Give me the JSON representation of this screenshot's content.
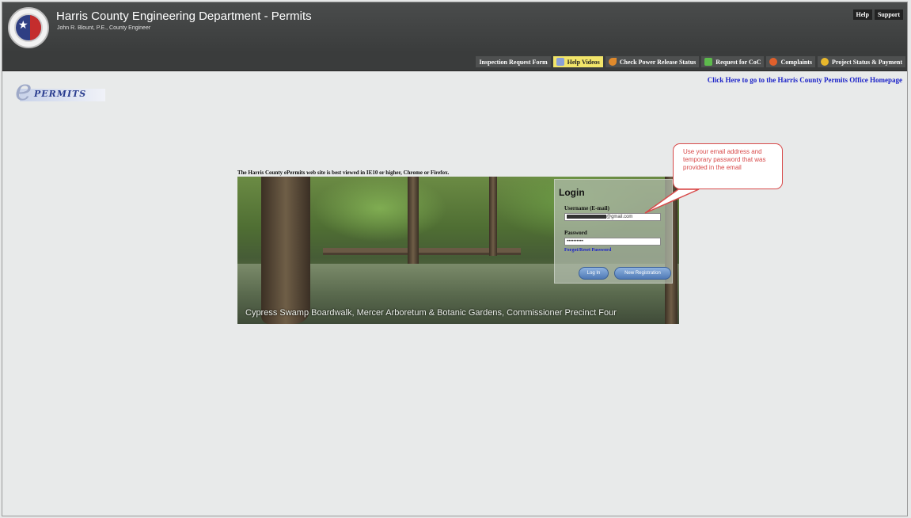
{
  "header": {
    "title": "Harris County Engineering Department - Permits",
    "subtitle": "John R. Blount, P.E., County Engineer",
    "top_links": [
      "Help",
      "Support"
    ]
  },
  "nav": {
    "items": [
      {
        "label": "Inspection Request Form",
        "icon": "",
        "active": false
      },
      {
        "label": "Help Videos",
        "icon": "video-icon",
        "active": true
      },
      {
        "label": "Check Power Release Status",
        "icon": "power-icon",
        "active": false
      },
      {
        "label": "Request for CoC",
        "icon": "checklist-icon",
        "active": false
      },
      {
        "label": "Complaints",
        "icon": "complaint-icon",
        "active": false
      },
      {
        "label": "Project Status & Payment",
        "icon": "status-icon",
        "active": false
      }
    ]
  },
  "logo": {
    "letter": "e",
    "text": "PERMITS"
  },
  "home_link": "Click Here to go to the Harris County Permits Office Homepage",
  "browser_note": "The Harris County ePermits web site is best viewed in IE10 or higher, Chrome or Firefox.",
  "login": {
    "title": "Login",
    "username_label": "Username (E-mail)",
    "username_value": "@gmail.com",
    "password_label": "Password",
    "password_value": "••••••••••",
    "forgot_link": "Forgot/Reset Password",
    "login_button": "Log In",
    "register_button": "New Registration"
  },
  "photo_caption": "Cypress Swamp Boardwalk, Mercer Arboretum & Botanic Gardens, Commissioner Precinct Four",
  "callout": "Use your email address and temporary password that was provided in the email",
  "colors": {
    "accent_link": "#1b22c8",
    "callout": "#d84a4a",
    "header": "#3a3c3c",
    "active_nav": "#f2e56a"
  }
}
